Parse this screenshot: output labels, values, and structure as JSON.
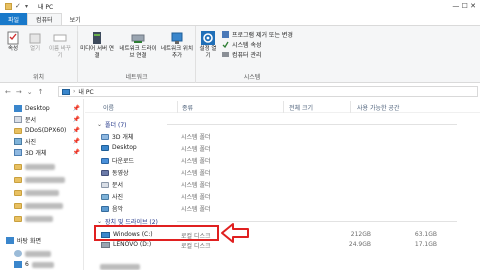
{
  "window": {
    "title": "내 PC",
    "controls": "—  ☐  ✕"
  },
  "tabs": [
    {
      "label": "파일"
    },
    {
      "label": "컴퓨터"
    },
    {
      "label": "보기"
    }
  ],
  "ribbon": {
    "properties_label": "속성",
    "open_label": "열기",
    "rename_label": "이름 바꾸기",
    "location_group": "위치",
    "media_access_label": "미디어 서버 연결",
    "map_drive_label": "네트워크 드라이브 연결",
    "add_network_location_label": "네트워크 위치 추가",
    "network_group": "네트워크",
    "open_settings_label": "설정 열기",
    "uninstall_label": "프로그램 제거 또는 변경",
    "system_props_label": "시스템 속성",
    "manage_label": "컴퓨터 관리",
    "system_group": "시스템"
  },
  "address": {
    "path": "내 PC",
    "nav_back": "←",
    "nav_forward": "→",
    "nav_down": "⌄",
    "nav_up": "↑",
    "sep": "›"
  },
  "sidebar": {
    "items": [
      {
        "label": "Desktop",
        "pinned": true
      },
      {
        "label": "문서",
        "pinned": true
      },
      {
        "label": "DDoS(DPX60)",
        "pinned": true
      },
      {
        "label": "사진",
        "pinned": true
      },
      {
        "label": "3D 개체",
        "pinned": true
      }
    ],
    "pin_glyph": "📌",
    "bottom_item": "바탕 화면",
    "partial_item": "6"
  },
  "columns": {
    "name": "이름",
    "type": "종류",
    "total": "전체 크기",
    "free": "사용 가능한 공간"
  },
  "folders_group": "폴더 (7)",
  "folders": [
    {
      "name": "3D 개체",
      "type": "시스템 폴더"
    },
    {
      "name": "Desktop",
      "type": "시스템 폴더"
    },
    {
      "name": "다운로드",
      "type": "시스템 폴더"
    },
    {
      "name": "동영상",
      "type": "시스템 폴더"
    },
    {
      "name": "문서",
      "type": "시스템 폴더"
    },
    {
      "name": "사진",
      "type": "시스템 폴더"
    },
    {
      "name": "음악",
      "type": "시스템 폴더"
    }
  ],
  "drives_group": "장치 및 드라이브 (2)",
  "drives": [
    {
      "name": "Windows (C:)",
      "type": "로컬 디스크",
      "total": "212GB",
      "free": "63.1GB"
    },
    {
      "name": "LENOVO (D:)",
      "type": "로컬 디스크",
      "total": "24.9GB",
      "free": "17.1GB"
    }
  ],
  "colors": {
    "accent": "#1979ca",
    "highlight": "#e02020",
    "folder": "#e8c061"
  }
}
